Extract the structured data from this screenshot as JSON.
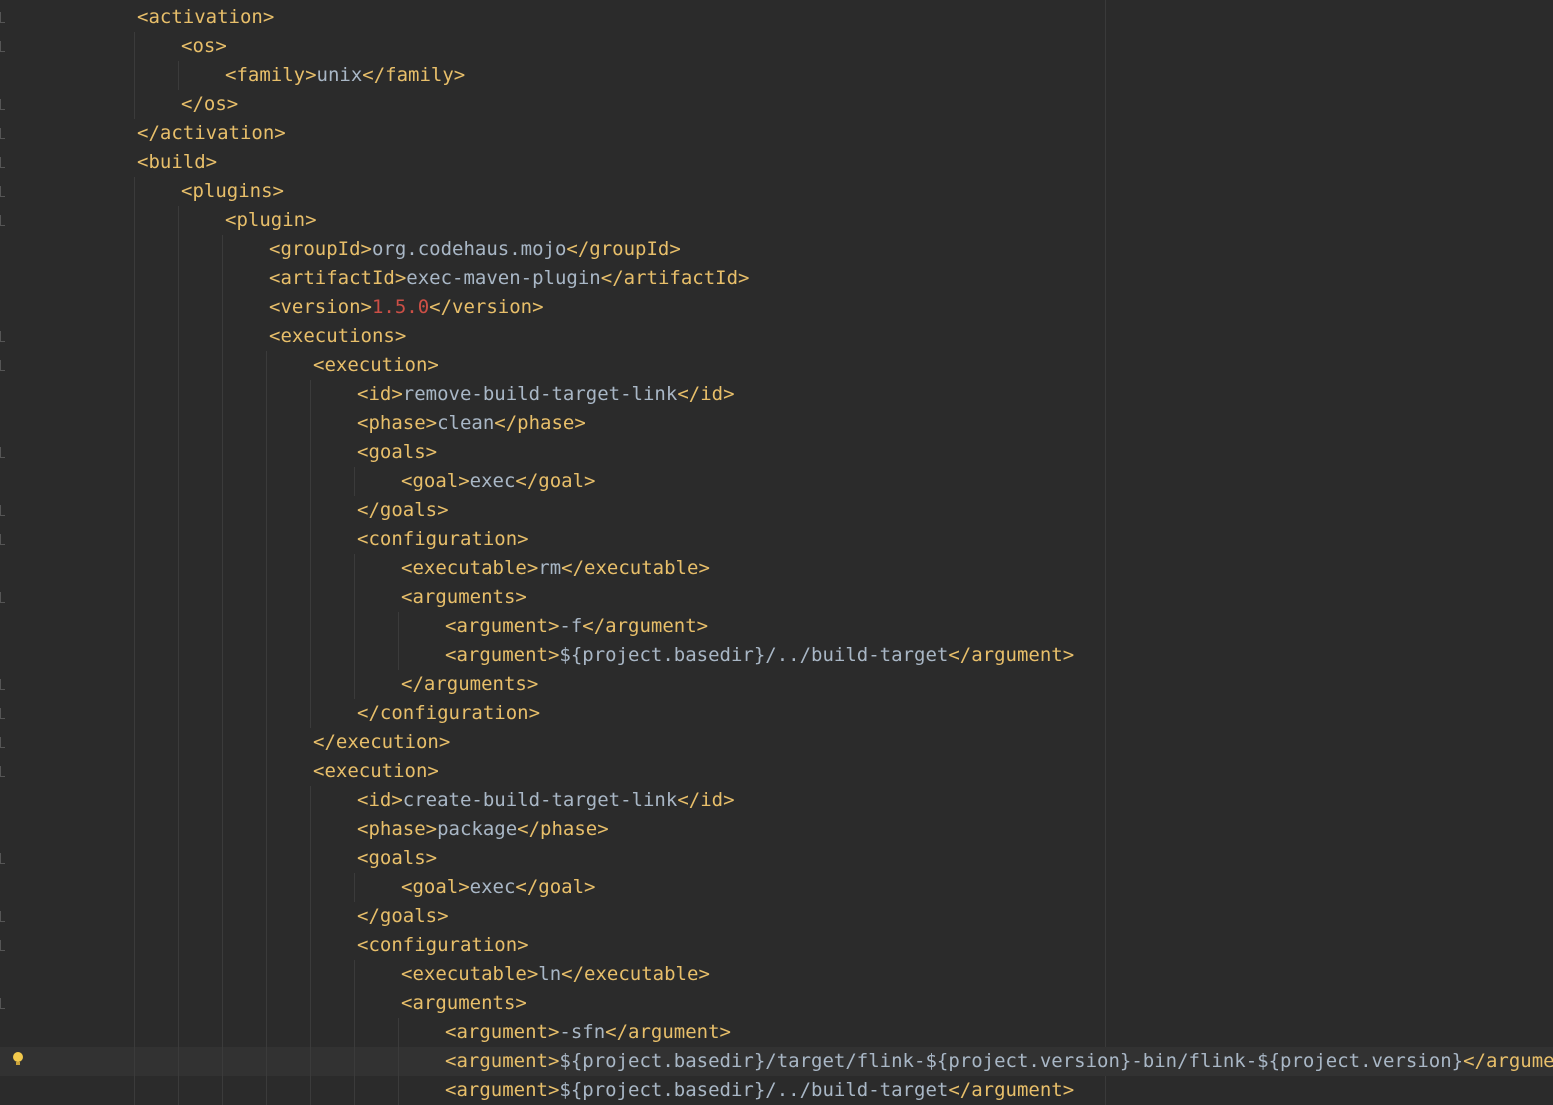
{
  "editor": {
    "language": "xml",
    "colors": {
      "background": "#2b2b2b",
      "tag": "#e8bf6a",
      "text": "#a9b7c6",
      "number": "#cc4f46",
      "current_line": "#323232"
    },
    "lines": [
      {
        "indent": 1,
        "fold": true,
        "tokens": [
          {
            "k": "tag",
            "v": "<activation>"
          }
        ]
      },
      {
        "indent": 2,
        "fold": true,
        "tokens": [
          {
            "k": "tag",
            "v": "<os>"
          }
        ]
      },
      {
        "indent": 3,
        "fold": false,
        "tokens": [
          {
            "k": "tag",
            "v": "<family>"
          },
          {
            "k": "text",
            "v": "unix"
          },
          {
            "k": "tag",
            "v": "</family>"
          }
        ]
      },
      {
        "indent": 2,
        "fold": true,
        "tokens": [
          {
            "k": "tag",
            "v": "</os>"
          }
        ]
      },
      {
        "indent": 1,
        "fold": true,
        "tokens": [
          {
            "k": "tag",
            "v": "</activation>"
          }
        ]
      },
      {
        "indent": 1,
        "fold": true,
        "tokens": [
          {
            "k": "tag",
            "v": "<build>"
          }
        ]
      },
      {
        "indent": 2,
        "fold": true,
        "tokens": [
          {
            "k": "tag",
            "v": "<plugins>"
          }
        ]
      },
      {
        "indent": 3,
        "fold": true,
        "tokens": [
          {
            "k": "tag",
            "v": "<plugin>"
          }
        ]
      },
      {
        "indent": 4,
        "fold": false,
        "tokens": [
          {
            "k": "tag",
            "v": "<groupId>"
          },
          {
            "k": "text",
            "v": "org.codehaus.mojo"
          },
          {
            "k": "tag",
            "v": "</groupId>"
          }
        ]
      },
      {
        "indent": 4,
        "fold": false,
        "tokens": [
          {
            "k": "tag",
            "v": "<artifactId>"
          },
          {
            "k": "text",
            "v": "exec-maven-plugin"
          },
          {
            "k": "tag",
            "v": "</artifactId>"
          }
        ]
      },
      {
        "indent": 4,
        "fold": false,
        "tokens": [
          {
            "k": "tag",
            "v": "<version>"
          },
          {
            "k": "num",
            "v": "1.5.0"
          },
          {
            "k": "tag",
            "v": "</version>"
          }
        ]
      },
      {
        "indent": 4,
        "fold": true,
        "tokens": [
          {
            "k": "tag",
            "v": "<executions>"
          }
        ]
      },
      {
        "indent": 5,
        "fold": true,
        "tokens": [
          {
            "k": "tag",
            "v": "<execution>"
          }
        ]
      },
      {
        "indent": 6,
        "fold": false,
        "tokens": [
          {
            "k": "tag",
            "v": "<id>"
          },
          {
            "k": "text",
            "v": "remove-build-target-link"
          },
          {
            "k": "tag",
            "v": "</id>"
          }
        ]
      },
      {
        "indent": 6,
        "fold": false,
        "tokens": [
          {
            "k": "tag",
            "v": "<phase>"
          },
          {
            "k": "text",
            "v": "clean"
          },
          {
            "k": "tag",
            "v": "</phase>"
          }
        ]
      },
      {
        "indent": 6,
        "fold": true,
        "tokens": [
          {
            "k": "tag",
            "v": "<goals>"
          }
        ]
      },
      {
        "indent": 7,
        "fold": false,
        "tokens": [
          {
            "k": "tag",
            "v": "<goal>"
          },
          {
            "k": "text",
            "v": "exec"
          },
          {
            "k": "tag",
            "v": "</goal>"
          }
        ]
      },
      {
        "indent": 6,
        "fold": true,
        "tokens": [
          {
            "k": "tag",
            "v": "</goals>"
          }
        ]
      },
      {
        "indent": 6,
        "fold": true,
        "tokens": [
          {
            "k": "tag",
            "v": "<configuration>"
          }
        ]
      },
      {
        "indent": 7,
        "fold": false,
        "tokens": [
          {
            "k": "tag",
            "v": "<executable>"
          },
          {
            "k": "text",
            "v": "rm"
          },
          {
            "k": "tag",
            "v": "</executable>"
          }
        ]
      },
      {
        "indent": 7,
        "fold": true,
        "tokens": [
          {
            "k": "tag",
            "v": "<arguments>"
          }
        ]
      },
      {
        "indent": 8,
        "fold": false,
        "tokens": [
          {
            "k": "tag",
            "v": "<argument>"
          },
          {
            "k": "text",
            "v": "-f"
          },
          {
            "k": "tag",
            "v": "</argument>"
          }
        ]
      },
      {
        "indent": 8,
        "fold": false,
        "tokens": [
          {
            "k": "tag",
            "v": "<argument>"
          },
          {
            "k": "text",
            "v": "${project.basedir}/../build-target"
          },
          {
            "k": "tag",
            "v": "</argument>"
          }
        ]
      },
      {
        "indent": 7,
        "fold": true,
        "tokens": [
          {
            "k": "tag",
            "v": "</arguments>"
          }
        ]
      },
      {
        "indent": 6,
        "fold": true,
        "tokens": [
          {
            "k": "tag",
            "v": "</configuration>"
          }
        ]
      },
      {
        "indent": 5,
        "fold": true,
        "tokens": [
          {
            "k": "tag",
            "v": "</execution>"
          }
        ]
      },
      {
        "indent": 5,
        "fold": true,
        "tokens": [
          {
            "k": "tag",
            "v": "<execution>"
          }
        ]
      },
      {
        "indent": 6,
        "fold": false,
        "tokens": [
          {
            "k": "tag",
            "v": "<id>"
          },
          {
            "k": "text",
            "v": "create-build-target-link"
          },
          {
            "k": "tag",
            "v": "</id>"
          }
        ]
      },
      {
        "indent": 6,
        "fold": false,
        "tokens": [
          {
            "k": "tag",
            "v": "<phase>"
          },
          {
            "k": "text",
            "v": "package"
          },
          {
            "k": "tag",
            "v": "</phase>"
          }
        ]
      },
      {
        "indent": 6,
        "fold": true,
        "tokens": [
          {
            "k": "tag",
            "v": "<goals>"
          }
        ]
      },
      {
        "indent": 7,
        "fold": false,
        "tokens": [
          {
            "k": "tag",
            "v": "<goal>"
          },
          {
            "k": "text",
            "v": "exec"
          },
          {
            "k": "tag",
            "v": "</goal>"
          }
        ]
      },
      {
        "indent": 6,
        "fold": true,
        "tokens": [
          {
            "k": "tag",
            "v": "</goals>"
          }
        ]
      },
      {
        "indent": 6,
        "fold": true,
        "tokens": [
          {
            "k": "tag",
            "v": "<configuration>"
          }
        ]
      },
      {
        "indent": 7,
        "fold": false,
        "tokens": [
          {
            "k": "tag",
            "v": "<executable>"
          },
          {
            "k": "text",
            "v": "ln"
          },
          {
            "k": "tag",
            "v": "</executable>"
          }
        ]
      },
      {
        "indent": 7,
        "fold": true,
        "tokens": [
          {
            "k": "tag",
            "v": "<arguments>"
          }
        ]
      },
      {
        "indent": 8,
        "fold": false,
        "tokens": [
          {
            "k": "tag",
            "v": "<argument>"
          },
          {
            "k": "text",
            "v": "-sfn"
          },
          {
            "k": "tag",
            "v": "</argument>"
          }
        ]
      },
      {
        "indent": 8,
        "fold": false,
        "current": true,
        "bulb": true,
        "tokens": [
          {
            "k": "tag",
            "v": "<argument>"
          },
          {
            "k": "text",
            "v": "${project.basedir}/target/flink-${project.version}-bin/flink-${project.version}"
          },
          {
            "k": "tag",
            "v": "</argument>"
          }
        ]
      },
      {
        "indent": 8,
        "fold": false,
        "tokens": [
          {
            "k": "tag",
            "v": "<argument>"
          },
          {
            "k": "text",
            "v": "${project.basedir}/../build-target"
          },
          {
            "k": "tag",
            "v": "</argument>"
          }
        ]
      }
    ]
  }
}
